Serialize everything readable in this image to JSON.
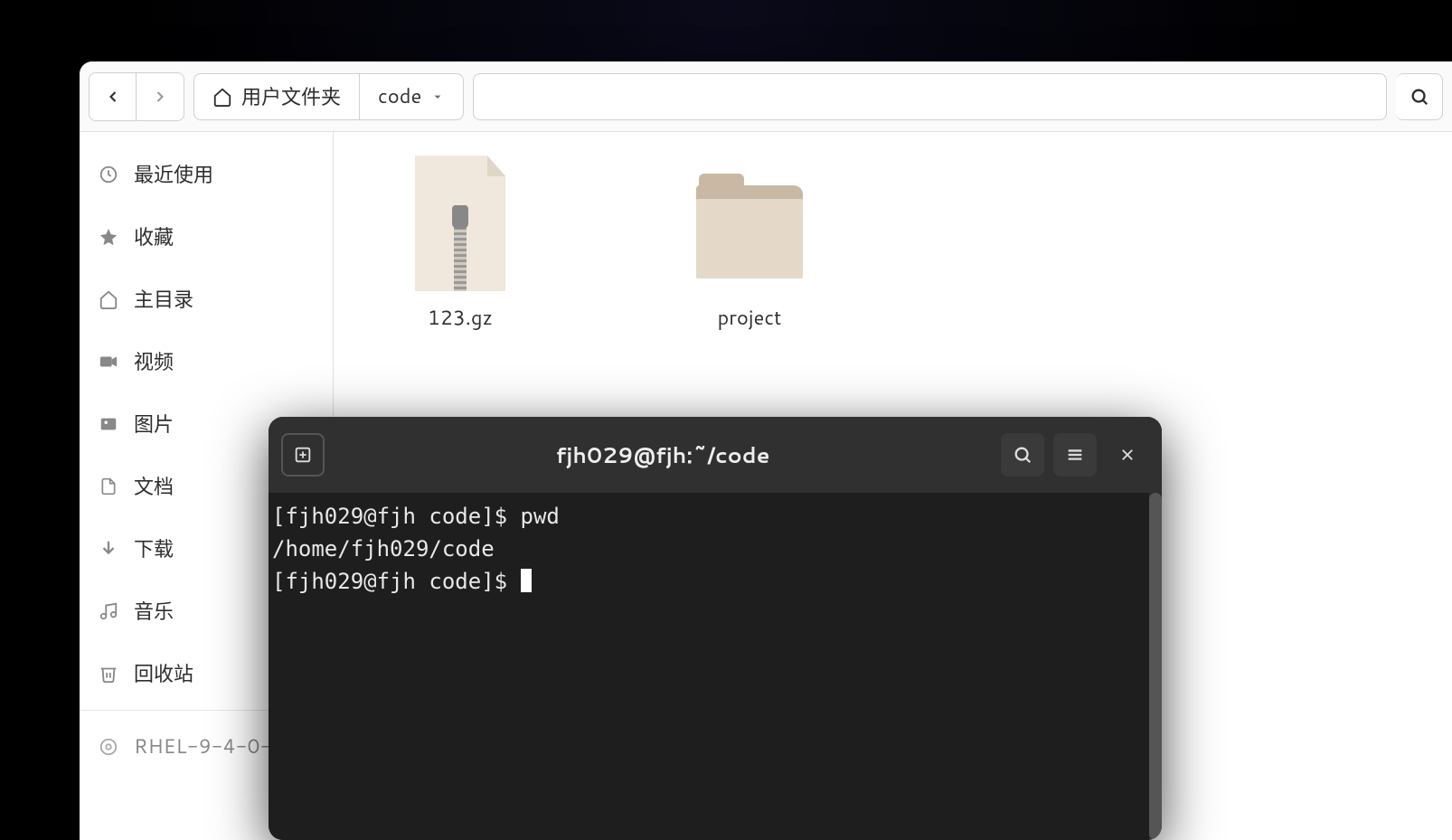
{
  "file_manager": {
    "breadcrumb": {
      "home_label": "用户文件夹",
      "current": "code"
    },
    "sidebar": {
      "items": [
        {
          "label": "最近使用",
          "icon": "clock-icon"
        },
        {
          "label": "收藏",
          "icon": "star-icon"
        },
        {
          "label": "主目录",
          "icon": "home-icon"
        },
        {
          "label": "视频",
          "icon": "video-icon"
        },
        {
          "label": "图片",
          "icon": "image-icon"
        },
        {
          "label": "文档",
          "icon": "document-icon"
        },
        {
          "label": "下载",
          "icon": "download-icon"
        },
        {
          "label": "音乐",
          "icon": "music-icon"
        },
        {
          "label": "回收站",
          "icon": "trash-icon"
        }
      ],
      "secondary": [
        {
          "label": "RHEL-9-4-0-…",
          "icon": "disc-icon"
        }
      ]
    },
    "files": [
      {
        "name": "123.gz",
        "type": "archive"
      },
      {
        "name": "project",
        "type": "folder"
      }
    ]
  },
  "terminal": {
    "title": "fjh029@fjh:~/code",
    "lines": [
      "[fjh029@fjh code]$ pwd",
      "/home/fjh029/code",
      "[fjh029@fjh code]$ "
    ]
  }
}
